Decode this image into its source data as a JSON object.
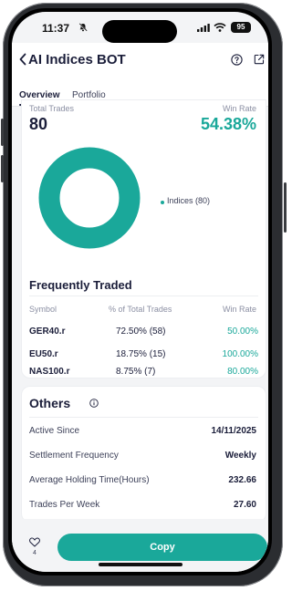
{
  "status_bar": {
    "time": "11:37",
    "battery": "95",
    "icons": [
      "bell-slash-icon",
      "signal-icon",
      "wifi-icon",
      "battery-icon"
    ]
  },
  "header": {
    "title": "AI Indices BOT",
    "icons": [
      "chevron-left-icon",
      "help-icon",
      "share-icon"
    ],
    "tabs": [
      {
        "label": "Overview",
        "active": true
      },
      {
        "label": "Portfolio",
        "active": false
      }
    ]
  },
  "stats": {
    "total_trades_label": "Total Trades",
    "total_trades": "80",
    "win_rate_label": "Win Rate",
    "win_rate": "54.38%",
    "donut": {
      "segments": [
        {
          "name": "Indices",
          "count": 80,
          "share": 1.0,
          "color": "#1aa89a"
        }
      ],
      "legend": "Indices (80)"
    }
  },
  "frequently_traded": {
    "title": "Frequently Traded",
    "headers": {
      "symbol": "Symbol",
      "pct": "% of Total Trades",
      "win": "Win Rate"
    },
    "rows": [
      {
        "symbol": "GER40.r",
        "pct": "72.50% (58)",
        "win": "50.00%"
      },
      {
        "symbol": "EU50.r",
        "pct": "18.75% (15)",
        "win": "100.00%"
      },
      {
        "symbol": "NAS100.r",
        "pct": "8.75% (7)",
        "win": "80.00%"
      }
    ]
  },
  "others": {
    "title": "Others",
    "items": [
      {
        "label": "Active Since",
        "value": "14/11/2025"
      },
      {
        "label": "Settlement Frequency",
        "value": "Weekly"
      },
      {
        "label": "Average Holding Time(Hours)",
        "value": "232.66"
      },
      {
        "label": "Trades Per Week",
        "value": "27.60"
      }
    ]
  },
  "bottom": {
    "likes": "4",
    "copy_label": "Copy"
  },
  "colors": {
    "accent": "#1aa89a",
    "text_dark": "#1b1e3a",
    "text_muted": "#8b8fa3"
  }
}
